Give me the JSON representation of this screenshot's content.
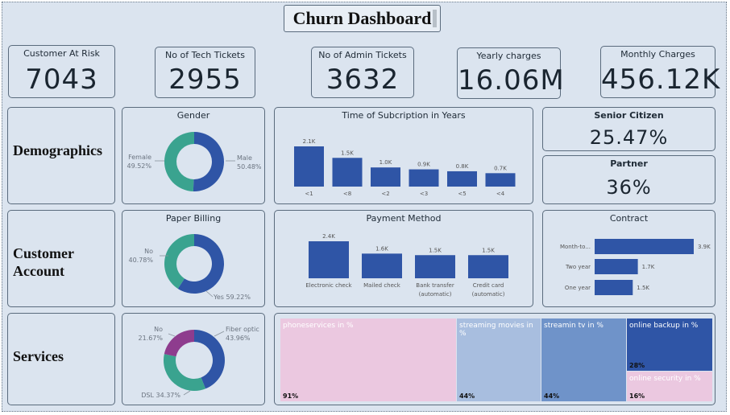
{
  "title": "Churn Dashboard",
  "kpis": [
    {
      "label": "Customer At Risk",
      "value": "7043"
    },
    {
      "label": "No of Tech Tickets",
      "value": "2955"
    },
    {
      "label": "No of Admin Tickets",
      "value": "3632"
    },
    {
      "label": "Yearly charges",
      "value": "16.06M"
    },
    {
      "label": "Monthly Charges",
      "value": "456.12K"
    }
  ],
  "sections": {
    "demographics": "Demographics",
    "customer_account": "Customer Account",
    "services": "Services"
  },
  "senior_citizen": {
    "label": "Senior Citizen",
    "value": "25.47%"
  },
  "partner": {
    "label": "Partner",
    "value": "36%"
  },
  "colors": {
    "blue": "#2f55a6",
    "teal": "#3aa38f",
    "purple": "#8e3c8e",
    "pink": "#ebc8e0",
    "lightblue": "#a8bedf",
    "midblue": "#6f93c9"
  },
  "chart_data": [
    {
      "type": "pie",
      "title": "Gender",
      "slices": [
        {
          "label": "Male",
          "value": 50.48,
          "display": "50.48%",
          "color": "#2f55a6"
        },
        {
          "label": "Female",
          "value": 49.52,
          "display": "49.52%",
          "color": "#3aa38f"
        }
      ]
    },
    {
      "type": "bar",
      "title": "Time of Subcription in Years",
      "categories": [
        "<1",
        "<8",
        "<2",
        "<3",
        "<5",
        "<4"
      ],
      "values": [
        2100,
        1500,
        1000,
        900,
        800,
        700
      ],
      "labels": [
        "2.1K",
        "1.5K",
        "1.0K",
        "0.9K",
        "0.8K",
        "0.7K"
      ]
    },
    {
      "type": "pie",
      "title": "Paper Billing",
      "slices": [
        {
          "label": "Yes",
          "value": 59.22,
          "display": "59.22%",
          "color": "#2f55a6"
        },
        {
          "label": "No",
          "value": 40.78,
          "display": "40.78%",
          "color": "#3aa38f"
        }
      ]
    },
    {
      "type": "bar",
      "title": "Payment Method",
      "categories": [
        [
          "Electronic check"
        ],
        [
          "Mailed check"
        ],
        [
          "Bank transfer",
          "(automatic)"
        ],
        [
          "Credit card",
          "(automatic)"
        ]
      ],
      "values": [
        2400,
        1600,
        1500,
        1500
      ],
      "labels": [
        "2.4K",
        "1.6K",
        "1.5K",
        "1.5K"
      ]
    },
    {
      "type": "bar",
      "orientation": "horizontal",
      "title": "Contract",
      "categories": [
        "Month-to...",
        "Two year",
        "One year"
      ],
      "values": [
        3900,
        1700,
        1500
      ],
      "labels": [
        "3.9K",
        "1.7K",
        "1.5K"
      ]
    },
    {
      "type": "pie",
      "slices": [
        {
          "label": "Fiber optic",
          "value": 43.96,
          "display": "43.96%",
          "color": "#2f55a6"
        },
        {
          "label": "DSL",
          "value": 34.37,
          "display": "34.37%",
          "color": "#3aa38f"
        },
        {
          "label": "No",
          "value": 21.67,
          "display": "21.67%",
          "color": "#8e3c8e"
        }
      ]
    },
    {
      "type": "treemap",
      "items": [
        {
          "label": "phoneservices in %",
          "value": "91%",
          "color": "#ebc8e0"
        },
        {
          "label": "streaming movies in %",
          "value": "44%",
          "color": "#a8bedf"
        },
        {
          "label": "streamin tv in %",
          "value": "44%",
          "color": "#6f93c9"
        },
        {
          "label": "online backup in %",
          "value": "28%",
          "color": "#2f55a6"
        },
        {
          "label": "online security in %",
          "value": "16%",
          "color": "#ebc8e0"
        }
      ]
    }
  ]
}
